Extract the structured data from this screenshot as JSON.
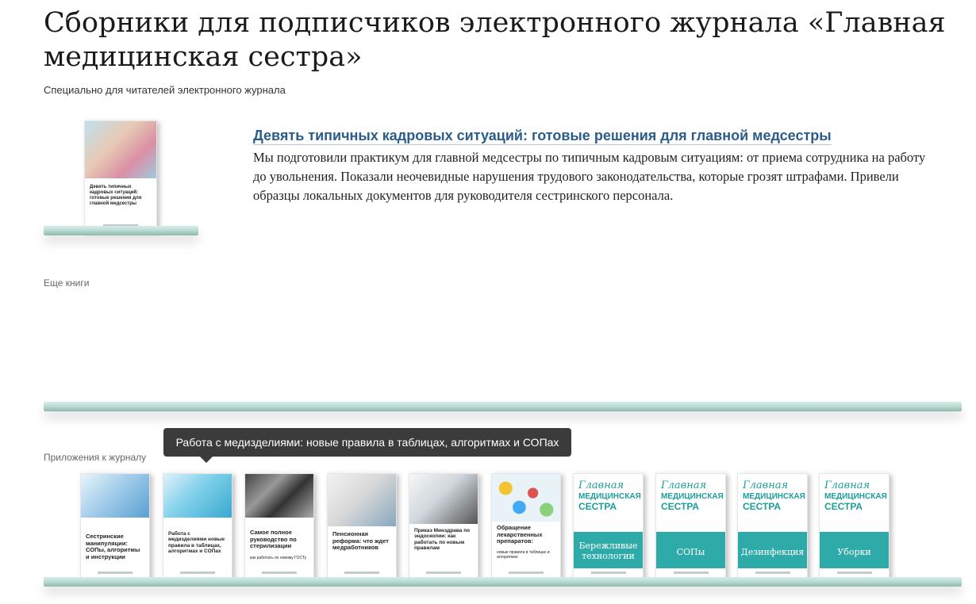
{
  "page": {
    "title": "Сборники для подписчиков электронного журнала «Главная медицинская сестра»",
    "subtitle": "Специально для читателей электронного журнала"
  },
  "featured": {
    "title": "Девять типичных кадровых ситуаций: готовые решения для главной медсестры",
    "description": "Мы подготовили практикум для главной медсестры по типичным кадровым ситуациям: от приема сотрудника на работу до увольнения. Показали неочевидные нарушения трудового законодательства, которые грозят штрафами. Привели образцы локальных документов для руководителя сестринского персонала.",
    "cover_text": "Девять типичных кадровых ситуаций: готовые решения для главной медсестры"
  },
  "more_books_label": "Еще книги",
  "appendix_label": "Приложения к журналу",
  "tooltip": "Работа с медизделиями: новые правила в таблицах, алгоритмах и СОПах",
  "journal_logo": {
    "line1": "Главная",
    "line2": "МЕДИЦИНСКАЯ",
    "line3": "СЕСТРА"
  },
  "appendix_books": [
    {
      "title": "Сестринские манипуляции: СОПы, алгоритмы и инструкции",
      "icon": "nurse-photo"
    },
    {
      "title": "Работа с медизделиями новые правила в таблицах, алгоритмах и СОПах",
      "icon": "iv-drip-photo"
    },
    {
      "title": "Самое полное руководство по стерилизации",
      "note": "как работать по новому ГОСТу",
      "icon": "instruments-photo"
    },
    {
      "title": "Пенсионная реформа: что ждет медработников",
      "icon": "doctor-photo"
    },
    {
      "title": "Приказ Минздрава по эндоскопии: как работать по новым правилам",
      "icon": "endoscope-photo"
    },
    {
      "title": "Обращение лекарственных препаратов:",
      "note": "новые правила в таблицах и алгоритмах",
      "icon": "pills-photo"
    }
  ],
  "journal_books": [
    {
      "label": "Бережливые технологии"
    },
    {
      "label": "СОПы"
    },
    {
      "label": "Дезинфекция"
    },
    {
      "label": "Уборки"
    }
  ],
  "colors": {
    "accent_teal": "#2eaba8",
    "link_blue": "#2b5d8a",
    "shelf": "#bcdcd4"
  }
}
